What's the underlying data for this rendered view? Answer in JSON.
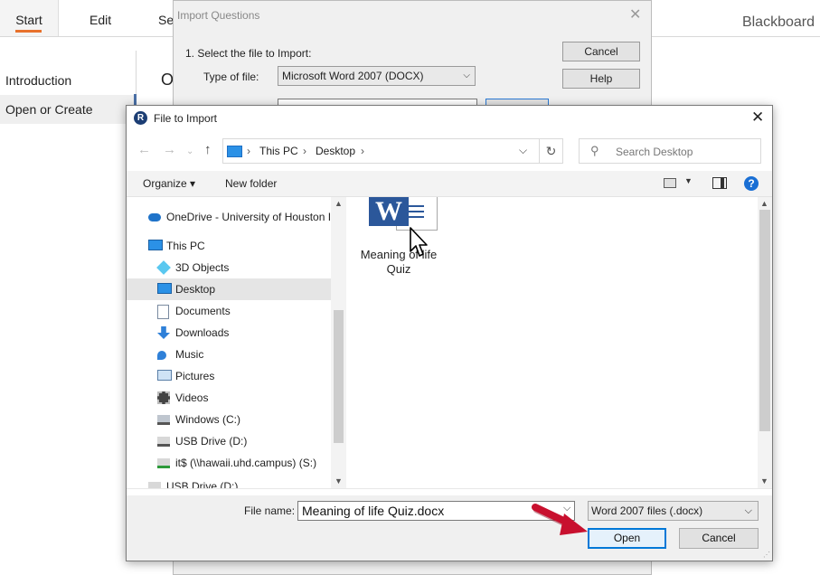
{
  "app": {
    "tabs": [
      "Start",
      "Edit",
      "Set"
    ],
    "brand": "Blackboard",
    "sidebar": [
      "Introduction",
      "Open or Create"
    ],
    "main_letter": "O"
  },
  "import_dialog": {
    "title": "Import Questions",
    "step1": "1.  Select the file to Import:",
    "type_label": "Type of file:",
    "type_value": "Microsoft Word 2007 (DOCX)",
    "cancel": "Cancel",
    "help": "Help"
  },
  "file_dialog": {
    "title": "File to Import",
    "app_logo": "R",
    "breadcrumb": [
      "This PC",
      "Desktop"
    ],
    "search_placeholder": "Search Desktop",
    "toolbar": {
      "organize": "Organize",
      "new_folder": "New folder"
    },
    "tree": [
      {
        "label": "OneDrive - University of Houston I",
        "icon": "onedrive-icon",
        "indent": 0
      },
      {
        "label": "This PC",
        "icon": "this-pc-icon",
        "indent": 0
      },
      {
        "label": "3D Objects",
        "icon": "3d-objects-icon",
        "indent": 1
      },
      {
        "label": "Desktop",
        "icon": "desktop-icon",
        "indent": 1,
        "selected": true
      },
      {
        "label": "Documents",
        "icon": "documents-icon",
        "indent": 1
      },
      {
        "label": "Downloads",
        "icon": "downloads-icon",
        "indent": 1
      },
      {
        "label": "Music",
        "icon": "music-icon",
        "indent": 1
      },
      {
        "label": "Pictures",
        "icon": "pictures-icon",
        "indent": 1
      },
      {
        "label": "Videos",
        "icon": "videos-icon",
        "indent": 1
      },
      {
        "label": "Windows (C:)",
        "icon": "drive-c-icon",
        "indent": 1
      },
      {
        "label": "USB Drive (D:)",
        "icon": "usb-drive-icon",
        "indent": 1
      },
      {
        "label": "it$ (\\\\hawaii.uhd.campus) (S:)",
        "icon": "network-drive-icon",
        "indent": 1
      },
      {
        "label": "USB Drive (D:)",
        "icon": "usb-drive-icon",
        "indent": 0
      }
    ],
    "files": [
      {
        "name": "Meaning of life Quiz",
        "icon": "word-document-icon",
        "badge": "W"
      }
    ],
    "file_name_label": "File name:",
    "file_name_value": "Meaning of life Quiz.docx",
    "file_type": "Word 2007 files (.docx)",
    "open": "Open",
    "cancel": "Cancel"
  },
  "colors": {
    "accent": "#0078d7",
    "tab_underline": "#e8712c",
    "word_blue": "#2b579a",
    "annotation_arrow": "#c8102e"
  }
}
